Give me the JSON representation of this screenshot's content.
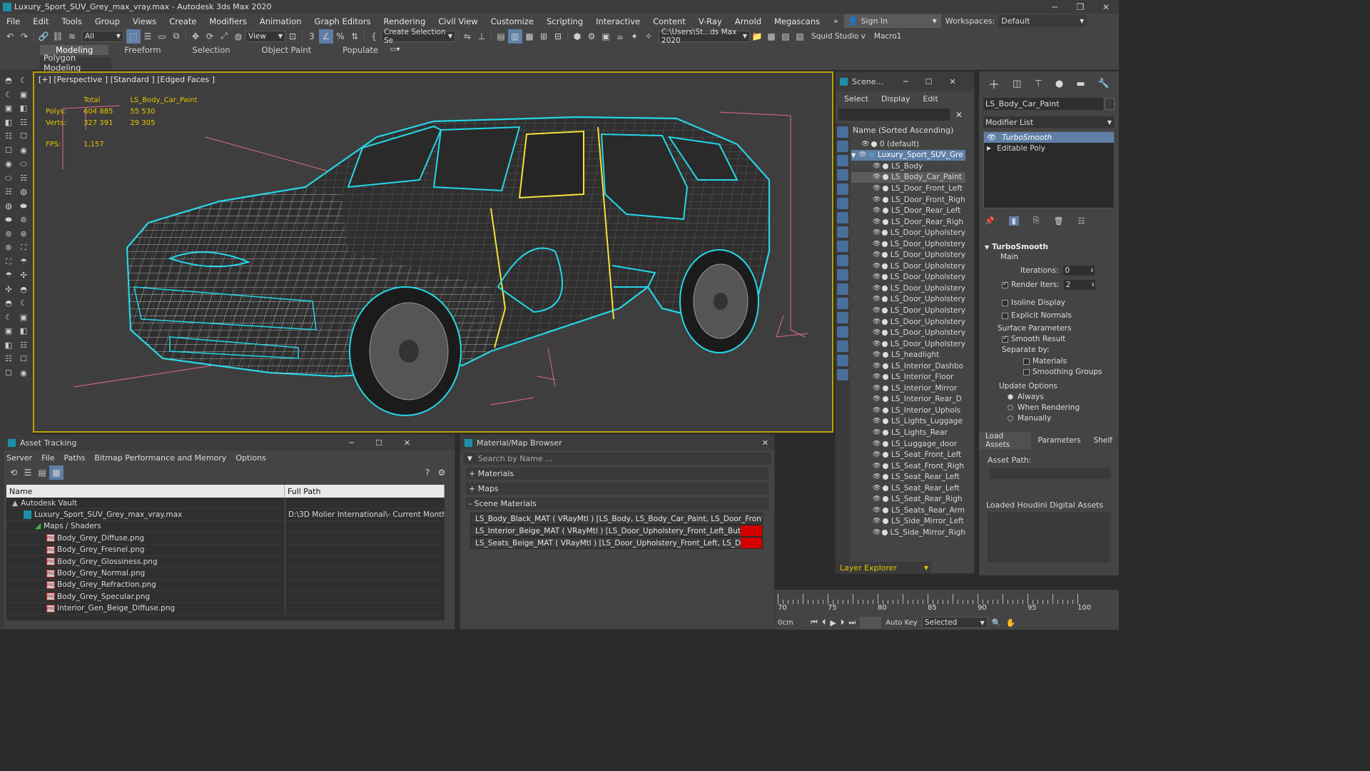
{
  "window": {
    "title": "Luxury_Sport_SUV_Grey_max_vray.max - Autodesk 3ds Max 2020"
  },
  "menu": [
    "File",
    "Edit",
    "Tools",
    "Group",
    "Views",
    "Create",
    "Modifiers",
    "Animation",
    "Graph Editors",
    "Rendering",
    "Civil View",
    "Customize",
    "Scripting",
    "Interactive",
    "Content",
    "V-Ray",
    "Arnold",
    "Megascans"
  ],
  "signin": "Sign In",
  "workspaces": {
    "label": "Workspaces:",
    "value": "Default"
  },
  "toolbar": {
    "filter": "All",
    "refcoord": "View",
    "selection_set": "Create Selection Se",
    "path": "C:\\Users\\St...ds Max 2020",
    "studio": "Squid Studio v",
    "macro": "Macro1"
  },
  "ribbon": {
    "tabs": [
      "Modeling",
      "Freeform",
      "Selection",
      "Object Paint",
      "Populate"
    ],
    "sub": "Polygon Modeling"
  },
  "viewport": {
    "label": "[+] [Perspective ] [Standard ] [Edged Faces ]",
    "stats": {
      "total_label": "Total",
      "object": "LS_Body_Car_Paint",
      "polys_label": "Polys:",
      "polys_total": "604 885",
      "polys_obj": "55 530",
      "verts_label": "Verts:",
      "verts_total": "327 391",
      "verts_obj": "29 305",
      "fps_label": "FPS:",
      "fps": "1,157"
    }
  },
  "scene": {
    "title": "Scene...",
    "menu": [
      "Select",
      "Display",
      "Edit"
    ],
    "sort": "Name (Sorted Ascending)",
    "rows": [
      {
        "name": "0 (default)",
        "level": 1
      },
      {
        "name": "Luxury_Sport_SUV_Gre",
        "level": 0,
        "sel": true
      },
      {
        "name": "LS_Body",
        "level": 2
      },
      {
        "name": "LS_Body_Car_Paint",
        "level": 2,
        "hi": true
      },
      {
        "name": "LS_Door_Front_Left",
        "level": 2
      },
      {
        "name": "LS_Door_Front_Righ",
        "level": 2
      },
      {
        "name": "LS_Door_Rear_Left",
        "level": 2
      },
      {
        "name": "LS_Door_Rear_Righ",
        "level": 2
      },
      {
        "name": "LS_Door_Upholstery",
        "level": 2
      },
      {
        "name": "LS_Door_Upholstery",
        "level": 2
      },
      {
        "name": "LS_Door_Upholstery",
        "level": 2
      },
      {
        "name": "LS_Door_Upholstery",
        "level": 2
      },
      {
        "name": "LS_Door_Upholstery",
        "level": 2
      },
      {
        "name": "LS_Door_Upholstery",
        "level": 2
      },
      {
        "name": "LS_Door_Upholstery",
        "level": 2
      },
      {
        "name": "LS_Door_Upholstery",
        "level": 2
      },
      {
        "name": "LS_Door_Upholstery",
        "level": 2
      },
      {
        "name": "LS_Door_Upholstery",
        "level": 2
      },
      {
        "name": "LS_Door_Upholstery",
        "level": 2
      },
      {
        "name": "LS_headlight",
        "level": 2
      },
      {
        "name": "LS_Interior_Dashbo",
        "level": 2
      },
      {
        "name": "LS_Interior_Floor",
        "level": 2
      },
      {
        "name": "LS_Interior_Mirror",
        "level": 2
      },
      {
        "name": "LS_Interior_Rear_D",
        "level": 2
      },
      {
        "name": "LS_Interior_Uphols",
        "level": 2
      },
      {
        "name": "LS_Lights_Luggage",
        "level": 2
      },
      {
        "name": "LS_Lights_Rear",
        "level": 2
      },
      {
        "name": "LS_Luggage_door",
        "level": 2
      },
      {
        "name": "LS_Seat_Front_Left",
        "level": 2
      },
      {
        "name": "LS_Seat_Front_Righ",
        "level": 2
      },
      {
        "name": "LS_Seat_Rear_Left",
        "level": 2
      },
      {
        "name": "LS_Seat_Rear_Left",
        "level": 2
      },
      {
        "name": "LS_Seat_Rear_Righ",
        "level": 2
      },
      {
        "name": "LS_Seats_Rear_Arm",
        "level": 2
      },
      {
        "name": "LS_Side_Mirror_Left",
        "level": 2
      },
      {
        "name": "LS_Side_Mirror_Righ",
        "level": 2
      }
    ],
    "layer_explorer": "Layer Explorer"
  },
  "command": {
    "object_name": "LS_Body_Car_Paint",
    "modifier_list": "Modifier List",
    "stack": [
      {
        "name": "TurboSmooth",
        "sel": true
      },
      {
        "name": "Editable Poly",
        "sel": false
      }
    ],
    "rollout": {
      "title": "TurboSmooth",
      "main": "Main",
      "iterations_label": "Iterations:",
      "iterations": "0",
      "render_iters_label": "Render Iters:",
      "render_iters": "2",
      "isoline": "Isoline Display",
      "explicit_normals": "Explicit Normals",
      "surface_params": "Surface Parameters",
      "smooth_result": "Smooth Result",
      "separate_by": "Separate by:",
      "materials": "Materials",
      "smoothing_groups": "Smoothing Groups",
      "update_options": "Update Options",
      "always": "Always",
      "when_rendering": "When Rendering",
      "manually": "Manually"
    },
    "asset_tabs": [
      "Load Assets",
      "Parameters",
      "Shelf"
    ],
    "asset_path": "Asset Path:",
    "loaded_houdini": "Loaded Houdini Digital Assets"
  },
  "asset_tracking": {
    "title": "Asset Tracking",
    "menu": [
      "Server",
      "File",
      "Paths",
      "Bitmap Performance and Memory",
      "Options"
    ],
    "col_name": "Name",
    "col_path": "Full Path",
    "rows": [
      {
        "name": "Autodesk Vault",
        "path": "",
        "indent": 1,
        "kind": "vault"
      },
      {
        "name": "Luxury_Sport_SUV_Grey_max_vray.max",
        "path": "D:\\3D Molier International\\- Current Month",
        "indent": 2,
        "kind": "max"
      },
      {
        "name": "Maps / Shaders",
        "path": "",
        "indent": 3,
        "kind": "folder"
      },
      {
        "name": "Body_Grey_Diffuse.png",
        "path": "",
        "indent": 4,
        "kind": "png"
      },
      {
        "name": "Body_Grey_Fresnel.png",
        "path": "",
        "indent": 4,
        "kind": "png"
      },
      {
        "name": "Body_Grey_Glossiness.png",
        "path": "",
        "indent": 4,
        "kind": "png"
      },
      {
        "name": "Body_Grey_Normal.png",
        "path": "",
        "indent": 4,
        "kind": "png"
      },
      {
        "name": "Body_Grey_Refraction.png",
        "path": "",
        "indent": 4,
        "kind": "png"
      },
      {
        "name": "Body_Grey_Specular.png",
        "path": "",
        "indent": 4,
        "kind": "png"
      },
      {
        "name": "Interior_Gen_Beige_Diffuse.png",
        "path": "",
        "indent": 4,
        "kind": "png"
      }
    ]
  },
  "material_browser": {
    "title": "Material/Map Browser",
    "search_placeholder": "Search by Name ...",
    "sections": [
      "+ Materials",
      "+ Maps",
      "- Scene Materials"
    ],
    "materials": [
      "LS_Body_Black_MAT ( VRayMtl ) [LS_Body, LS_Body_Car_Paint, LS_Door_Front...",
      "LS_Interior_Beige_MAT ( VRayMtl ) [LS_Door_Upholstery_Front_Left_Buttons, L...",
      "LS_Seats_Beige_MAT ( VRayMtl ) [LS_Door_Upholstery_Front_Left, LS_Door_U..."
    ]
  },
  "timeline": {
    "ticks": [
      "70",
      "75",
      "80",
      "85",
      "90",
      "95",
      "100"
    ],
    "unit": "0cm",
    "autokey": "Auto Key",
    "selected": "Selected"
  },
  "colors": {
    "accent": "#5f7fa6",
    "viewport_border": "#b9a300",
    "stats": "#e3c600",
    "wire_cyan": "#25d7e8",
    "wire_yellow": "#f3e23a"
  }
}
